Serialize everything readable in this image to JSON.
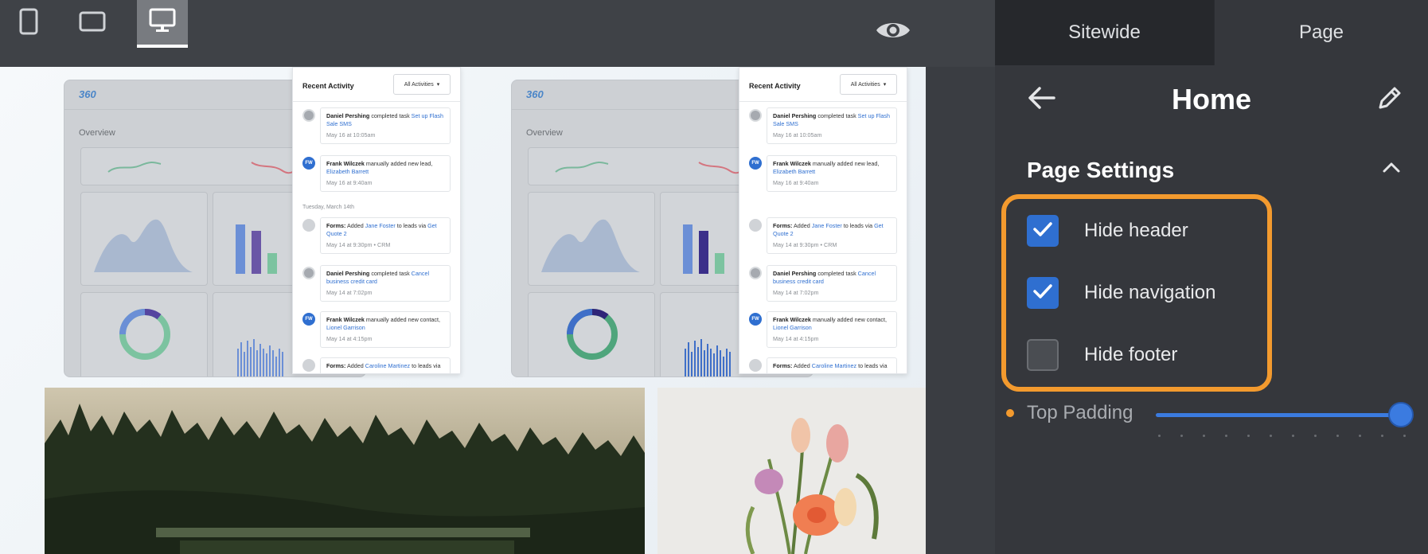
{
  "toolbar": {
    "devices": [
      {
        "name": "mobile",
        "icon": "mobile-device-icon",
        "active": false
      },
      {
        "name": "tablet",
        "icon": "tablet-device-icon",
        "active": false
      },
      {
        "name": "desktop",
        "icon": "desktop-device-icon",
        "active": true
      }
    ],
    "preview_icon": "eye-icon"
  },
  "canvas": {
    "dashboard_cards": [
      {
        "logo": "360",
        "overview_label": "Overview"
      },
      {
        "logo": "360",
        "overview_label": "Overview"
      }
    ],
    "activity_panel": {
      "title": "Recent Activity",
      "filter": "All Activities",
      "day_label": "Tuesday, March 14th",
      "items": [
        {
          "who": "Daniel Pershing",
          "text": " completed task ",
          "link": "Set up Flash Sale SMS",
          "meta": "May 16 at 10:05am",
          "avatar": "photo"
        },
        {
          "who": "Frank Wilczek",
          "text": " manually added new lead, ",
          "link": "Elizabeth Barrett",
          "meta": "May 16 at 9:40am",
          "avatar": "FW"
        },
        {
          "who": "Forms:",
          "text": " Added ",
          "link": "Jane Foster",
          "text2": " to leads via ",
          "link2": "Get Quote 2",
          "meta": "May 14 at 9:30pm  •  CRM",
          "avatar": "grey"
        },
        {
          "who": "Daniel Pershing",
          "text": " completed task ",
          "link": "Cancel business credit card",
          "meta": "May 14 at 7:02pm",
          "avatar": "photo"
        },
        {
          "who": "Frank Wilczek",
          "text": " manually added new contact, ",
          "link": "Lionel Garrison",
          "meta": "May 14 at 4:15pm",
          "avatar": "FW"
        },
        {
          "who": "Forms:",
          "text": " Added ",
          "link": "Caroline Martinez",
          "text2": " to leads via",
          "meta": "",
          "avatar": "grey"
        }
      ]
    }
  },
  "sidebar": {
    "tabs": [
      {
        "label": "Sitewide",
        "active": false
      },
      {
        "label": "Page",
        "active": true
      }
    ],
    "page_title": "Home",
    "section_title": "Page Settings",
    "checkboxes": [
      {
        "label": "Hide header",
        "checked": true
      },
      {
        "label": "Hide navigation",
        "checked": true
      },
      {
        "label": "Hide footer",
        "checked": false
      }
    ],
    "top_padding": {
      "label": "Top Padding",
      "value_fraction": 1.0
    }
  },
  "colors": {
    "accent_blue": "#2f6fd0",
    "highlight_orange": "#f39a2e",
    "sidebar_bg": "#35373c",
    "link_blue": "#2f6fd0"
  }
}
